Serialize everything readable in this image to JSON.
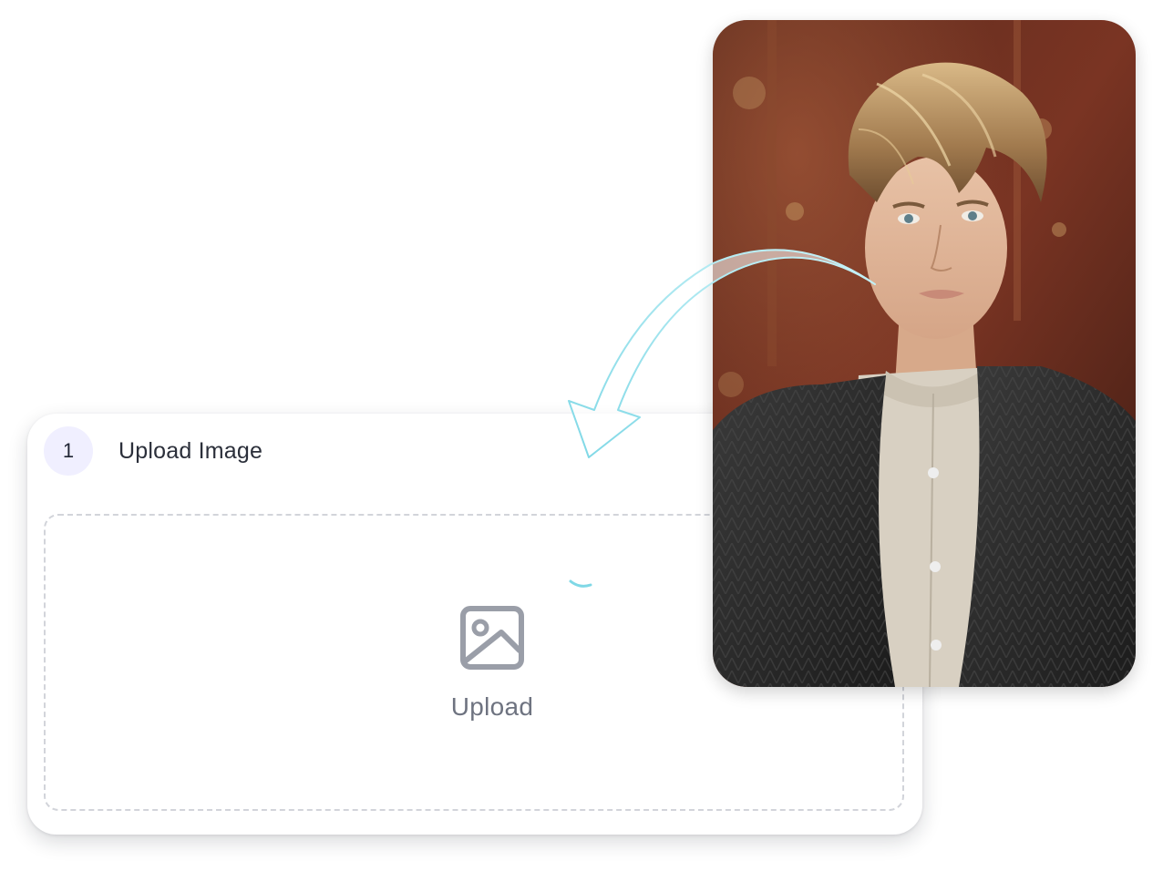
{
  "step": {
    "number": "1",
    "title": "Upload Image"
  },
  "dropzone": {
    "label": "Upload",
    "icon": "image-icon"
  },
  "photo": {
    "icon": "portrait-photo"
  },
  "colors": {
    "badge_bg": "#f0efff",
    "arrow": "#7fd8e6",
    "dashed_border": "#d2d4da",
    "icon_gray": "#9a9ea8"
  }
}
